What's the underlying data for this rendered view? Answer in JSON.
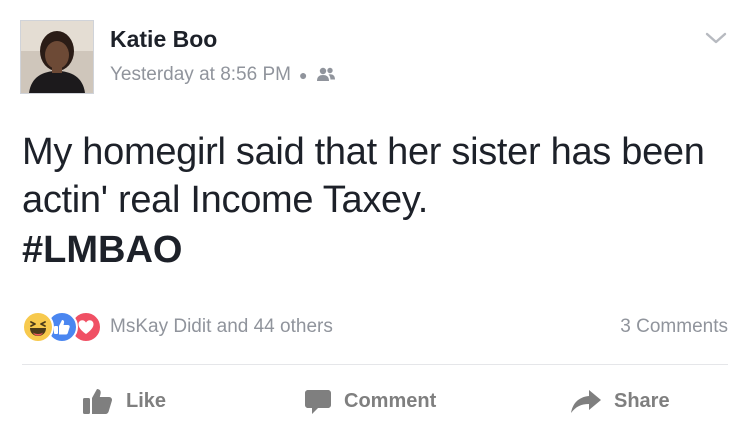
{
  "post": {
    "author_name": "Katie Boo",
    "timestamp": "Yesterday at 8:56 PM",
    "audience_icon": "friends-icon",
    "options_icon": "chevron-down-icon",
    "text": "My homegirl said that her sister has been actin' real Income Taxey.",
    "hashtag": "#LMBAO"
  },
  "reactions": {
    "icons": [
      "haha-icon",
      "like-icon",
      "love-icon"
    ],
    "summary": "MsKay Didit and 44 others",
    "comments": "3 Comments"
  },
  "actions": {
    "like_label": "Like",
    "comment_label": "Comment",
    "share_label": "Share"
  },
  "colors": {
    "text": "#1d2129",
    "secondary": "#90949c",
    "action": "#7f7f7f",
    "like_reaction": "#4a86f0",
    "love_reaction": "#f05064",
    "haha_reaction": "#f7c94d",
    "divider": "#e5e6e9"
  }
}
